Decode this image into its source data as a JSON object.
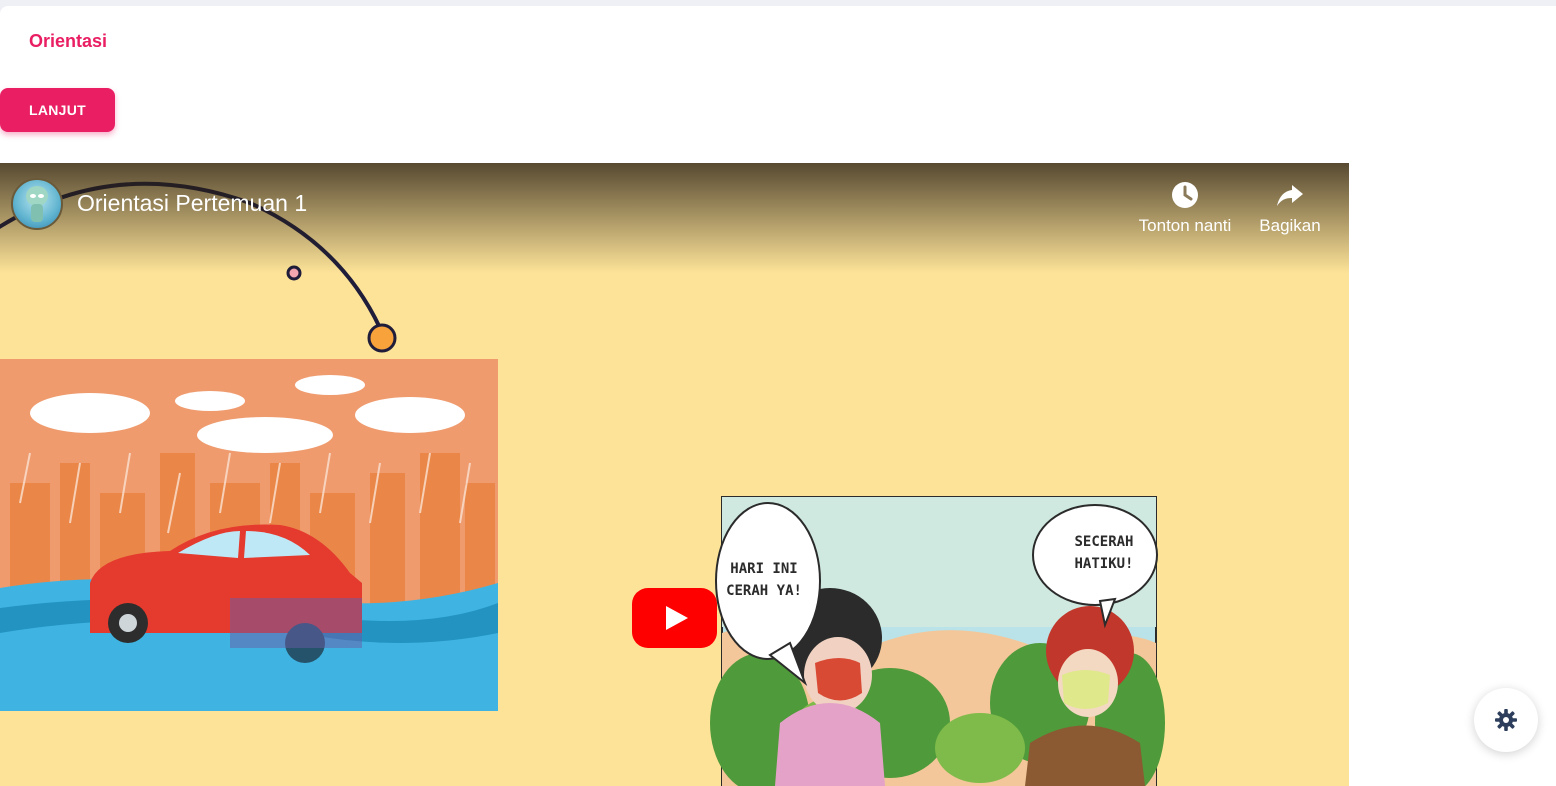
{
  "section": {
    "title": "Orientasi"
  },
  "actions": {
    "next_label": "LANJUT"
  },
  "video": {
    "title": "Orientasi Pertemuan 1",
    "watch_later_label": "Tonton nanti",
    "share_label": "Bagikan",
    "comic": {
      "bubble_left": [
        "HARI INI",
        "CERAH YA!"
      ],
      "bubble_right": [
        "SECERAH",
        "HATIKU!"
      ]
    }
  },
  "colors": {
    "accent": "#e91e63",
    "video_background": "#fde398",
    "youtube_red": "#ff0000",
    "settings_icon": "#2c3e5c"
  },
  "icons": {
    "watch_later": "clock-icon",
    "share": "share-icon",
    "play": "play-icon",
    "settings": "gear-icon"
  }
}
